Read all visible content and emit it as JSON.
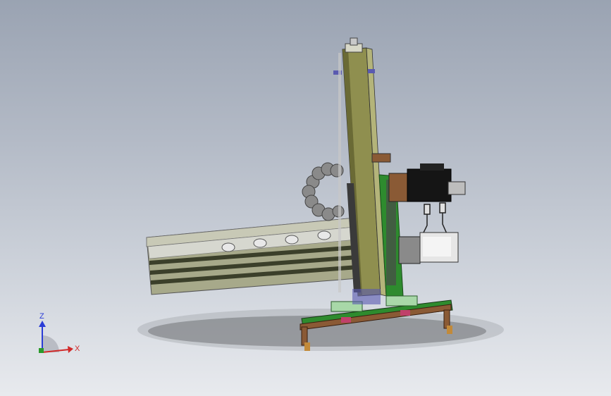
{
  "viewport": {
    "background_top": "#9aa3b2",
    "background_bottom": "#e8eaee"
  },
  "model": {
    "description_hidden": "",
    "colors": {
      "column": "#8f8f4f",
      "column_dark": "#6a6a35",
      "beam": "#a7a98a",
      "beam_stripe": "#3b3f2a",
      "green_part": "#2e8b2e",
      "motor_black": "#151515",
      "motor_gray": "#d8d8d8",
      "chain": "#7a7a7a",
      "brown": "#8a5a35",
      "pink": "#c0406a",
      "blue_clip": "#5a5ab0",
      "shadow": "#6e6f72"
    }
  },
  "triad": {
    "z_label": "Z",
    "x_label": "X",
    "z_color": "#2a3cd6",
    "x_color": "#d12a2a",
    "y_color": "#2a9a2a"
  }
}
